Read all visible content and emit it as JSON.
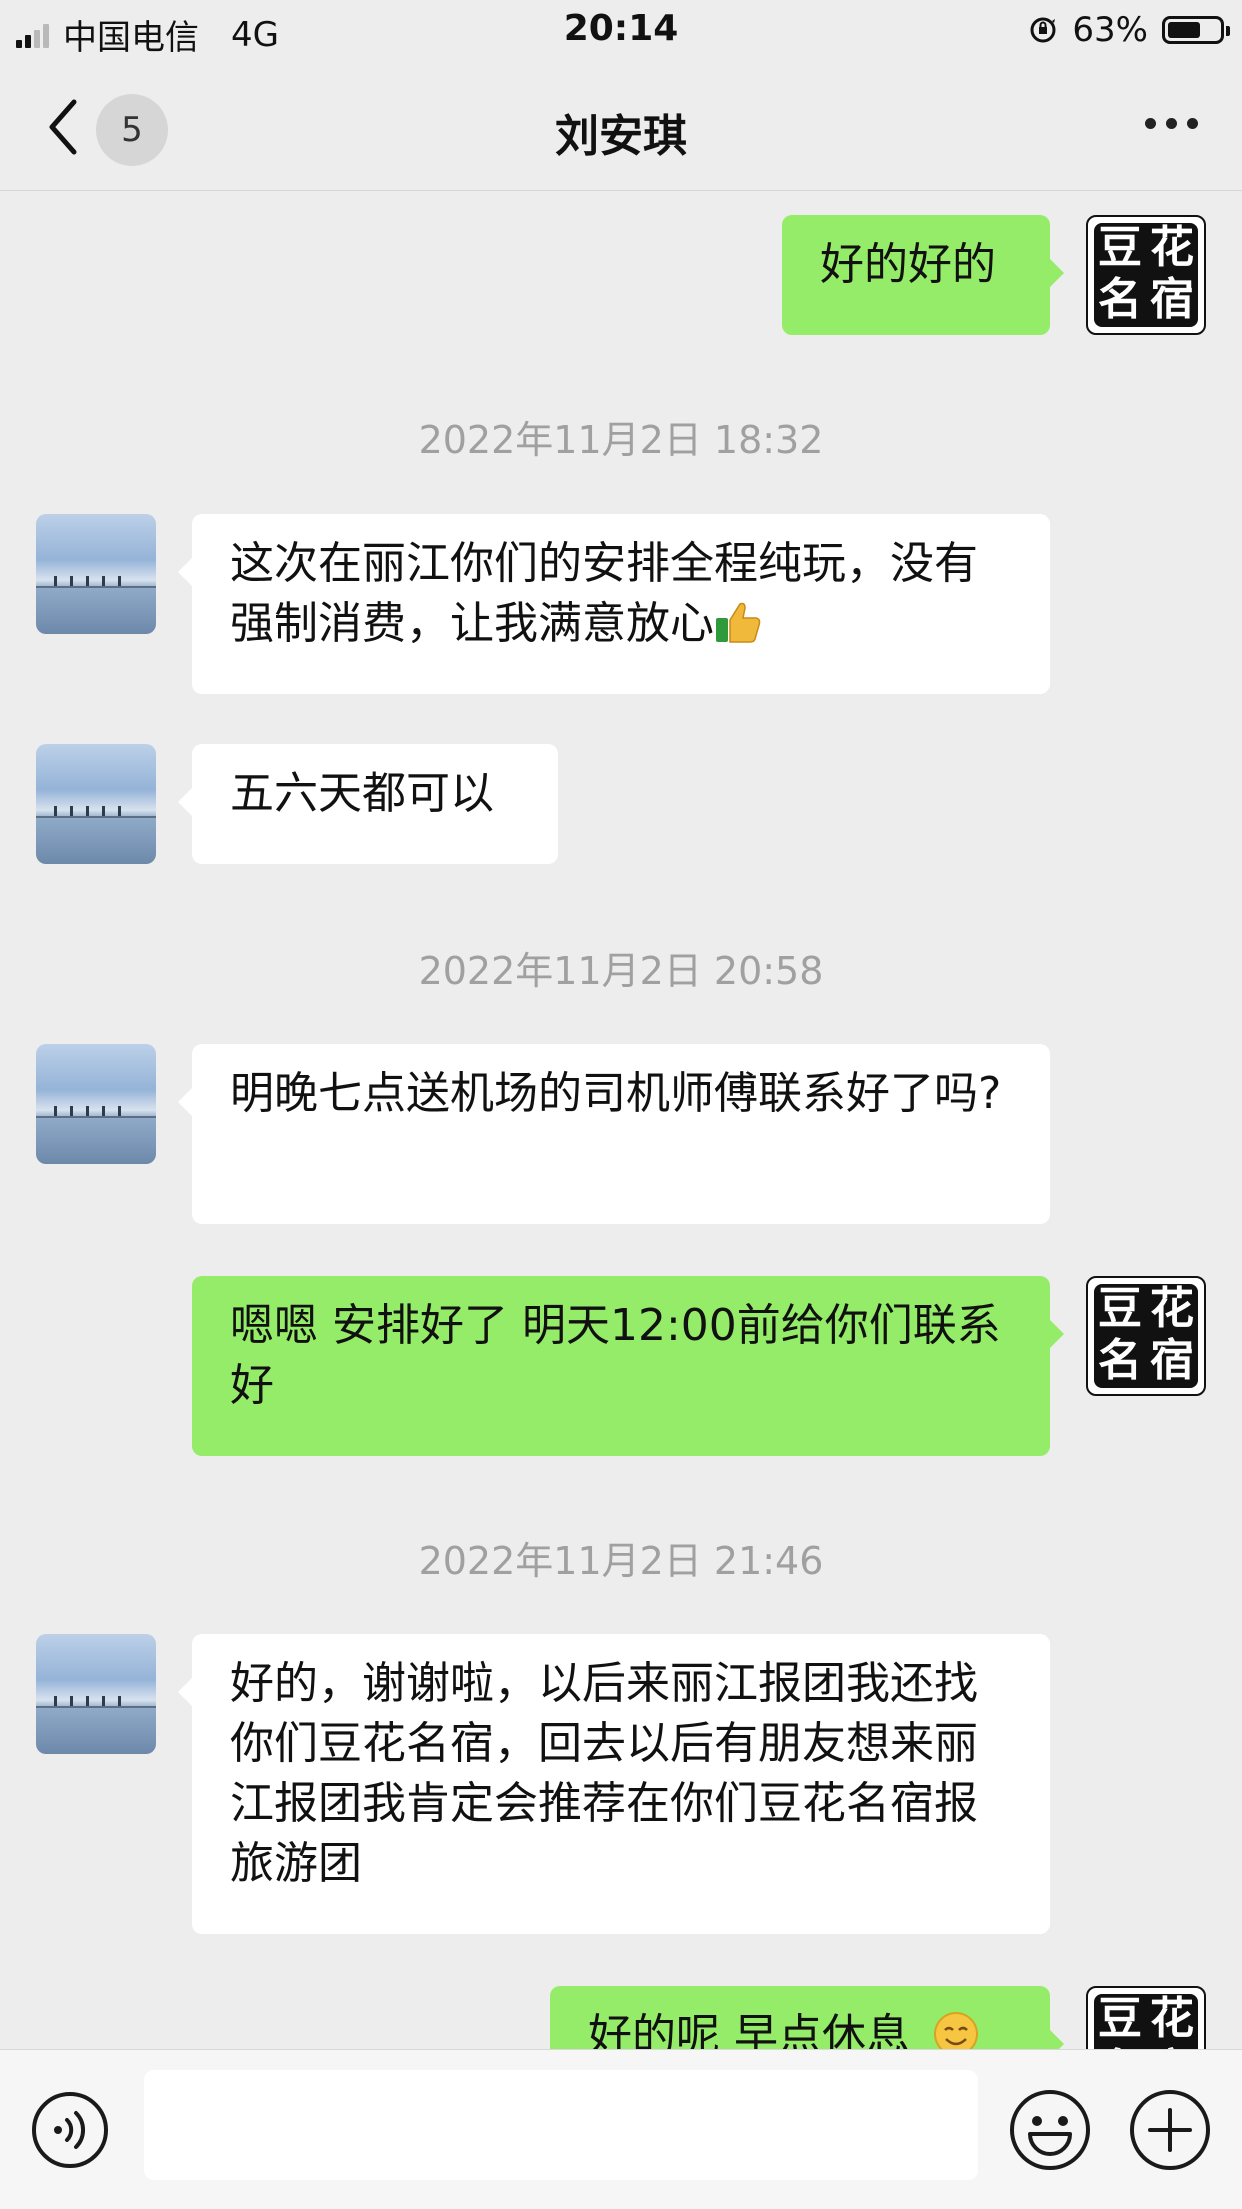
{
  "status_bar": {
    "carrier": "中国电信",
    "network": "4G",
    "time": "20:14",
    "battery": "63%",
    "battery_level": 0.63
  },
  "nav": {
    "unread_count": "5",
    "title": "刘安琪"
  },
  "chat": {
    "messages": [
      {
        "type": "out",
        "text": "好的好的"
      },
      {
        "type": "timestamp",
        "text": "2022年11月2日 18:32"
      },
      {
        "type": "in",
        "text": "这次在丽江你们的安排全程纯玩，没有强制消费，让我满意放心",
        "emoji": "thumbs-up"
      },
      {
        "type": "in",
        "text": "五六天都可以"
      },
      {
        "type": "timestamp",
        "text": "2022年11月2日 20:58"
      },
      {
        "type": "in",
        "text": "明晚七点送机场的司机师傅联系好了吗?"
      },
      {
        "type": "out",
        "text": "嗯嗯 安排好了 明天12:00前给你们联系好"
      },
      {
        "type": "timestamp",
        "text": "2022年11月2日 21:46"
      },
      {
        "type": "in",
        "text": "好的，谢谢啦，以后来丽江报团我还找你们豆花名宿，回去以后有朋友想来丽江报团我肯定会推荐在你们豆花名宿报旅游团"
      },
      {
        "type": "out",
        "text": "好的呢 早点休息",
        "emoji": "smile"
      }
    ],
    "self_avatar_text": [
      "豆",
      "花",
      "名",
      "宿"
    ]
  },
  "colors": {
    "background": "#ededed",
    "outgoing_bubble": "#95ec69",
    "incoming_bubble": "#ffffff",
    "timestamp": "#a0a0a0"
  },
  "icons": [
    "back-chevron-icon",
    "more-icon",
    "voice-icon",
    "emoji-icon",
    "plus-icon",
    "thumbs-up-icon",
    "smile-emoji-icon",
    "screen-rotation-lock-icon",
    "battery-icon",
    "signal-icon"
  ]
}
